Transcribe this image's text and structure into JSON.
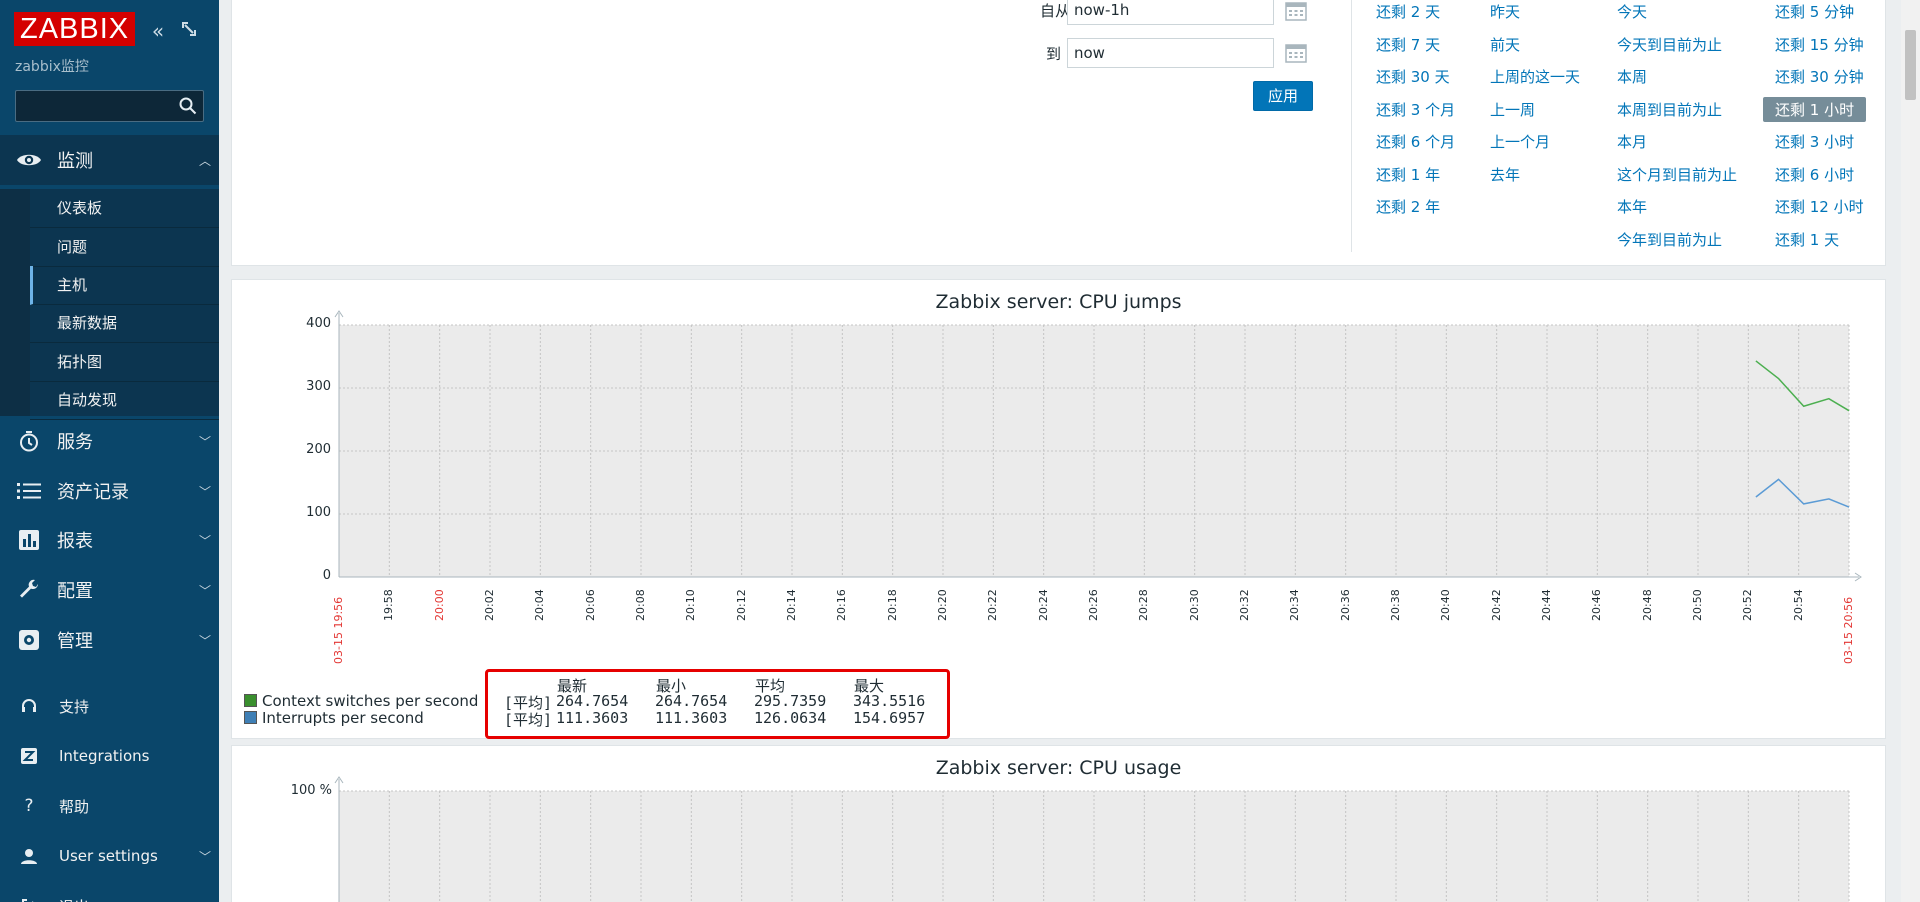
{
  "sidebar": {
    "logo": "ZABBIX",
    "server_name": "zabbix监控",
    "search_placeholder": "",
    "groups": [
      {
        "label": "监测",
        "icon": "eye-icon"
      },
      {
        "label": "服务",
        "icon": "stopwatch-icon"
      },
      {
        "label": "资产记录",
        "icon": "list-icon"
      },
      {
        "label": "报表",
        "icon": "bar-chart-icon"
      },
      {
        "label": "配置",
        "icon": "wrench-icon"
      },
      {
        "label": "管理",
        "icon": "gear-icon"
      }
    ],
    "monitoring_items": [
      "仪表板",
      "问题",
      "主机",
      "最新数据",
      "拓扑图",
      "自动发现"
    ],
    "bottom_items": [
      {
        "label": "支持",
        "icon": "headset-icon"
      },
      {
        "label": "Integrations",
        "icon": "integrations-icon"
      },
      {
        "label": "帮助",
        "icon": "help-icon"
      },
      {
        "label": "User settings",
        "icon": "user-icon"
      },
      {
        "label": "退出",
        "icon": "logout-icon"
      }
    ]
  },
  "filter": {
    "from_label": "自从",
    "from_value": "now-1h",
    "to_label": "到",
    "to_value": "now",
    "apply_label": "应用",
    "quick_ranges": [
      [
        "还剩 2 天",
        "还剩 7 天",
        "还剩 30 天",
        "还剩 3 个月",
        "还剩 6 个月",
        "还剩 1 年",
        "还剩 2 年"
      ],
      [
        "昨天",
        "前天",
        "上周的这一天",
        "上一周",
        "上一个月",
        "去年"
      ],
      [
        "今天",
        "今天到目前为止",
        "本周",
        "本周到目前为止",
        "本月",
        "这个月到目前为止",
        "本年",
        "今年到目前为止"
      ],
      [
        "还剩 5 分钟",
        "还剩 15 分钟",
        "还剩 30 分钟",
        "还剩 1 小时",
        "还剩 3 小时",
        "还剩 6 小时",
        "还剩 12 小时",
        "还剩 1 天"
      ]
    ],
    "selected_range": "还剩 1 小时"
  },
  "chart_data": [
    {
      "type": "line",
      "title": "Zabbix server: CPU jumps",
      "ylim": [
        0,
        400
      ],
      "yticks": [
        0,
        100,
        200,
        300,
        400
      ],
      "x_ticks": [
        "03-15 19:56",
        "19:58",
        "20:00",
        "20:02",
        "20:04",
        "20:06",
        "20:08",
        "20:10",
        "20:12",
        "20:14",
        "20:16",
        "20:18",
        "20:20",
        "20:22",
        "20:24",
        "20:26",
        "20:28",
        "20:30",
        "20:32",
        "20:34",
        "20:36",
        "20:38",
        "20:40",
        "20:42",
        "20:44",
        "20:46",
        "20:48",
        "20:50",
        "20:52",
        "20:54",
        "03-15 20:56"
      ],
      "x_ticks_highlight": [
        "03-15 19:56",
        "20:00",
        "03-15 20:56"
      ],
      "x_range_minutes": [
        0,
        60
      ],
      "series": [
        {
          "name": "Context switches per second",
          "color": "#4caf50",
          "x_minutes": [
            56.3,
            57.2,
            58.2,
            59.2,
            60
          ],
          "values": [
            343,
            315,
            271,
            283,
            264
          ]
        },
        {
          "name": "Interrupts per second",
          "color": "#5b9bd5",
          "x_minutes": [
            56.3,
            57.2,
            58.2,
            59.2,
            60
          ],
          "values": [
            127,
            155,
            116,
            124,
            111
          ]
        }
      ],
      "legend": {
        "headers": [
          "最新",
          "最小",
          "平均",
          "最大"
        ],
        "rows": [
          {
            "name": "Context switches per second",
            "func": "[平均]",
            "values": [
              "264.7654",
              "264.7654",
              "295.7359",
              "343.5516"
            ],
            "color": "#3a8f2e"
          },
          {
            "name": "Interrupts per second",
            "func": "[平均]",
            "values": [
              "111.3603",
              "111.3603",
              "126.0634",
              "154.6957"
            ],
            "color": "#3f7fb5"
          }
        ]
      }
    },
    {
      "type": "line",
      "title": "Zabbix server: CPU usage",
      "yticks_visible": [
        "100 %"
      ],
      "series": []
    }
  ]
}
